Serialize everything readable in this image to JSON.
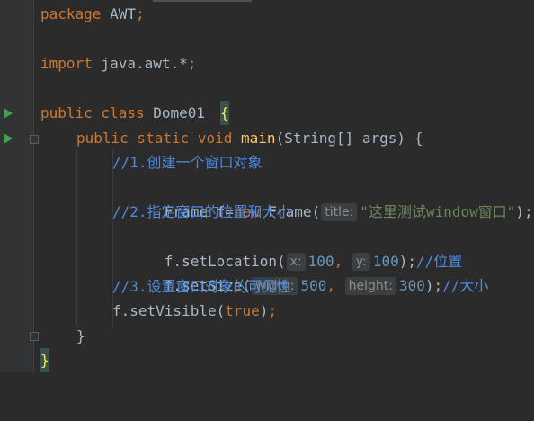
{
  "editor": {
    "lines": [
      {
        "id": "l1",
        "tokens": [
          [
            "kw",
            "package"
          ],
          [
            "ident",
            " AWT"
          ],
          [
            "kw",
            ";"
          ]
        ]
      },
      {
        "id": "l2",
        "tokens": []
      },
      {
        "id": "l3",
        "tokens": [
          [
            "kw",
            "import"
          ],
          [
            "ident",
            " java.awt.*"
          ],
          [
            "kw",
            ";"
          ]
        ]
      },
      {
        "id": "l4",
        "tokens": []
      },
      {
        "id": "l5",
        "tokens": [
          [
            "kw",
            "public class"
          ],
          [
            "ident",
            " Dome01 "
          ]
        ]
      },
      {
        "id": "l6",
        "tokens": [
          [
            "kw",
            "public static void"
          ],
          [
            "ident",
            " "
          ],
          [
            "fn",
            "main"
          ],
          [
            "ident",
            "(String[] args) {"
          ]
        ]
      },
      {
        "id": "l7",
        "tokens": [
          [
            "cmt",
            "//1.创建一个窗口对象"
          ]
        ]
      },
      {
        "id": "l8",
        "tokens": [
          [
            "ident",
            "Frame f="
          ],
          [
            "kw",
            "new"
          ],
          [
            "ident",
            " Frame("
          ]
        ]
      },
      {
        "id": "l9",
        "tokens": [
          [
            "cmt",
            "//2.指定窗口的位置和大小"
          ]
        ]
      },
      {
        "id": "l10",
        "tokens": [
          [
            "ident",
            "f.setLocation("
          ]
        ]
      },
      {
        "id": "l11",
        "tokens": [
          [
            "ident",
            "f.setSize("
          ]
        ]
      },
      {
        "id": "l12",
        "tokens": [
          [
            "cmt",
            "//3.设置窗口对象的可见性"
          ]
        ]
      },
      {
        "id": "l13",
        "tokens": [
          [
            "ident",
            "f.setVisible("
          ],
          [
            "kw",
            "true"
          ],
          [
            "ident",
            ")"
          ],
          [
            "kw",
            ";"
          ]
        ]
      },
      {
        "id": "l14",
        "tokens": [
          [
            "ident",
            "}"
          ]
        ]
      },
      {
        "id": "l15",
        "tokens": []
      }
    ],
    "line5_brace": "{",
    "line15_brace": "}",
    "frame_hint_label": "title:",
    "frame_arg": "\"这里测试window窗口\"",
    "frame_tail": ");",
    "loc_hint_x": "x:",
    "loc_x": "100",
    "loc_comma": ",",
    "loc_hint_y": "y:",
    "loc_y": "100",
    "loc_tail": ");",
    "loc_comment": "//位置",
    "size_hint_w": "width:",
    "size_w": "500",
    "size_comma": ",",
    "size_hint_h": "height:",
    "size_h": "300",
    "size_tail": ");",
    "size_comment": "//大小"
  },
  "gutter": {
    "run_icons": [
      "run-class-icon",
      "run-main-icon"
    ]
  },
  "colors": {
    "background": "#2b2b2b",
    "gutter": "#313335",
    "keyword": "#cc7832",
    "string": "#6a8759",
    "number": "#6897bb",
    "comment": "#4c8be2",
    "function": "#ffc66d",
    "brace_highlight": "#ffef28",
    "run_icon": "#499c54"
  }
}
